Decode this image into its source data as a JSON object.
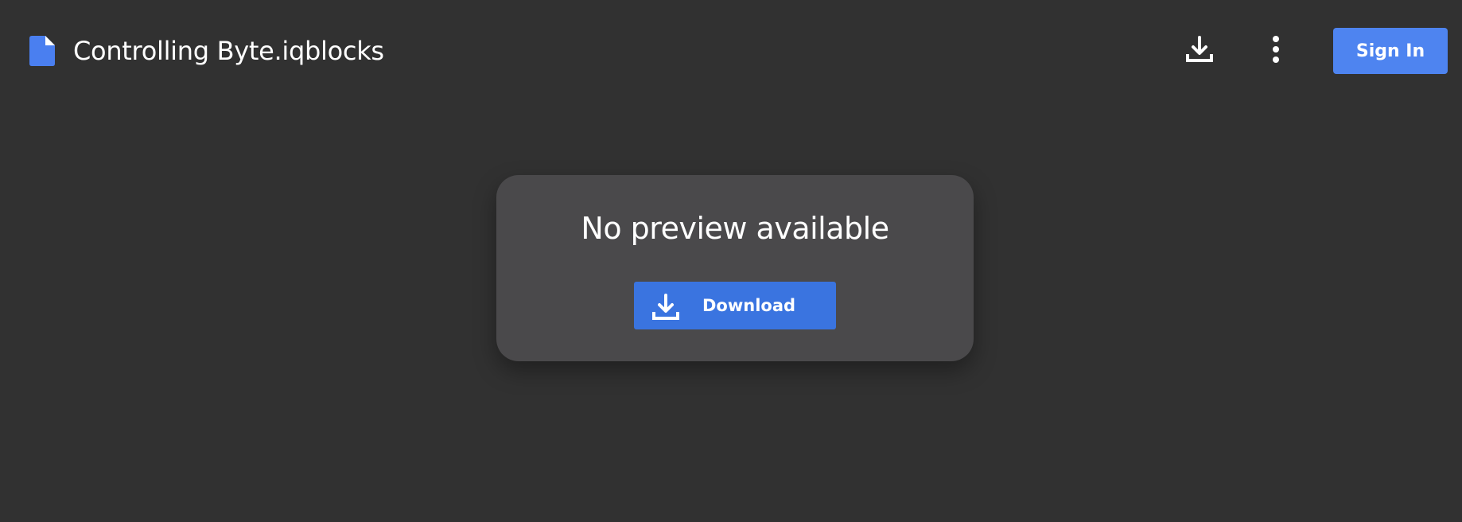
{
  "header": {
    "file_title": "Controlling Byte.iqblocks",
    "file_icon": "document-icon",
    "download_icon": "download-icon",
    "more_icon": "more-vertical-icon",
    "signin_label": "Sign In"
  },
  "preview": {
    "message": "No preview available",
    "download_label": "Download",
    "download_icon": "download-icon"
  },
  "colors": {
    "background": "#313131",
    "card": "#4a494b",
    "accent": "#3a74e0",
    "signin": "#4e84f0",
    "file_icon": "#4a7ff0"
  }
}
